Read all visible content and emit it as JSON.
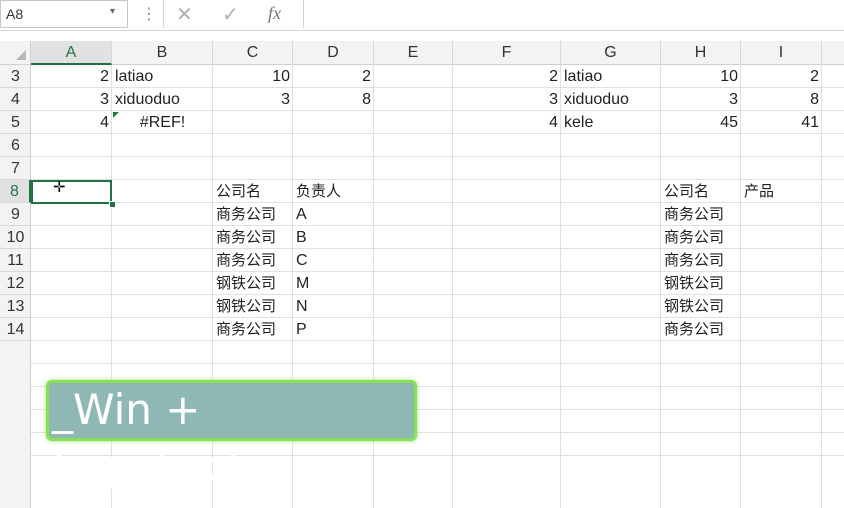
{
  "formula_bar": {
    "name_box": "A8",
    "name_box_arrow": "▾",
    "dots": "⋮",
    "cancel_icon": "✕",
    "enter_icon": "✓",
    "fx_label": "fx",
    "formula": ""
  },
  "columns": [
    "A",
    "B",
    "C",
    "D",
    "E",
    "F",
    "G",
    "H",
    "I"
  ],
  "selected_column": "A",
  "rows": [
    "3",
    "4",
    "5",
    "6",
    "7",
    "8",
    "9",
    "10",
    "11",
    "12",
    "13",
    "14"
  ],
  "selected_row": "8",
  "cells": {
    "A3": "2",
    "B3": "latiao",
    "C3": "10",
    "D3": "2",
    "F3": "2",
    "G3": "latiao",
    "H3": "10",
    "I3": "2",
    "A4": "3",
    "B4": "xiduoduo",
    "C4": "3",
    "D4": "8",
    "F4": "3",
    "G4": "xiduoduo",
    "H4": "3",
    "I4": "8",
    "A5": "4",
    "B5": "#REF!",
    "F5": "4",
    "G5": "kele",
    "H5": "45",
    "I5": "41",
    "C8": "公司名",
    "D8": "负责人",
    "H8": "公司名",
    "I8": "产品",
    "C9": "商务公司",
    "D9": "A",
    "H9": "商务公司",
    "C10": "商务公司",
    "D10": "B",
    "H10": "商务公司",
    "C11": "商务公司",
    "D11": "C",
    "H11": "商务公司",
    "C12": "钢铁公司",
    "D12": "M",
    "H12": "钢铁公司",
    "C13": "钢铁公司",
    "D13": "N",
    "H13": "钢铁公司",
    "C14": "商务公司",
    "D14": "P",
    "H14": "商务公司"
  },
  "overlay": {
    "text": "_Win + CapsLock_"
  },
  "colors": {
    "selection": "#217346",
    "banner_bg": "#8fb8b4",
    "banner_border": "#86e05a"
  }
}
